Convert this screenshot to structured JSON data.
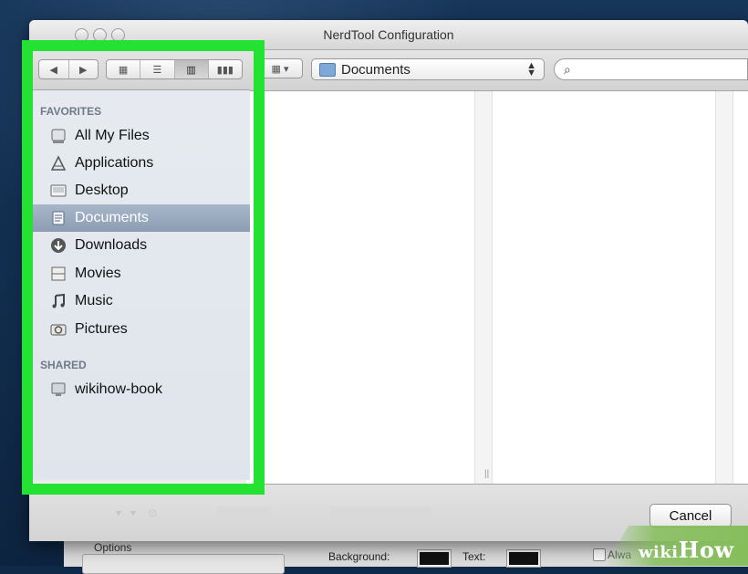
{
  "window": {
    "title": "NerdTool Configuration"
  },
  "toolbar": {
    "location": "Documents",
    "search_placeholder": ""
  },
  "sidebar": {
    "favorites_heading": "FAVORITES",
    "shared_heading": "SHARED",
    "favorites": [
      {
        "label": "All My Files",
        "icon": "all-files-icon"
      },
      {
        "label": "Applications",
        "icon": "applications-icon"
      },
      {
        "label": "Desktop",
        "icon": "desktop-icon"
      },
      {
        "label": "Documents",
        "icon": "documents-icon",
        "selected": true
      },
      {
        "label": "Downloads",
        "icon": "downloads-icon"
      },
      {
        "label": "Movies",
        "icon": "movies-icon"
      },
      {
        "label": "Music",
        "icon": "music-icon"
      },
      {
        "label": "Pictures",
        "icon": "pictures-icon"
      }
    ],
    "shared": [
      {
        "label": "wikihow-book",
        "icon": "computer-icon"
      }
    ]
  },
  "bottom": {
    "cancel_label": "Cancel"
  },
  "background_window": {
    "options_label": "Options",
    "background_label": "Background:",
    "text_label": "Text:",
    "always_label": "Alwa"
  },
  "watermark": {
    "wiki": "wiki",
    "how": "How"
  },
  "colors": {
    "highlight": "#23e232",
    "selection": "#8c9db3"
  }
}
